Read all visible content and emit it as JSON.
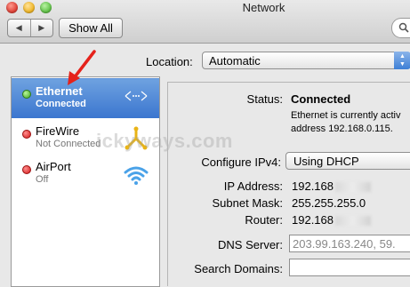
{
  "window": {
    "title": "Network"
  },
  "toolbar": {
    "back_label": "◀",
    "forward_label": "▶",
    "show_all_label": "Show All"
  },
  "location": {
    "label": "Location:",
    "value": "Automatic"
  },
  "services": [
    {
      "name": "Ethernet",
      "status": "Connected",
      "status_color": "green",
      "icon": "ethernet-icon"
    },
    {
      "name": "FireWire",
      "status": "Not Connected",
      "status_color": "red",
      "icon": "firewire-icon"
    },
    {
      "name": "AirPort",
      "status": "Off",
      "status_color": "red",
      "icon": "airport-icon"
    }
  ],
  "details": {
    "status_label": "Status:",
    "status_value": "Connected",
    "status_desc_1": "Ethernet is currently activ",
    "status_desc_2": "address 192.168.0.115.",
    "configure_label": "Configure IPv4:",
    "configure_value": "Using DHCP",
    "ip_label": "IP Address:",
    "ip_value": "192.168",
    "subnet_label": "Subnet Mask:",
    "subnet_value": "255.255.255.0",
    "router_label": "Router:",
    "router_value": "192.168",
    "dns_label": "DNS Server:",
    "dns_value": "203.99.163.240, 59.",
    "search_label": "Search Domains:",
    "search_value": ""
  },
  "watermark": "ickyways.com",
  "colors": {
    "selection": "#3b76cf",
    "arrow": "#e5221b"
  }
}
